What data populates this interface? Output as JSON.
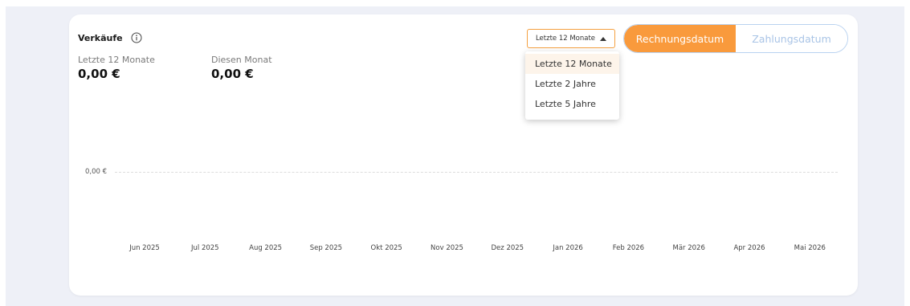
{
  "card": {
    "title": "Verkäufe",
    "stats": [
      {
        "label": "Letzte 12 Monate",
        "value": "0,00 €"
      },
      {
        "label": "Diesen Monat",
        "value": "0,00 €"
      }
    ]
  },
  "controls": {
    "range_selected": "Letzte 12 Monate",
    "range_options": [
      "Letzte 12 Monate",
      "Letzte 2 Jahre",
      "Letzte 5 Jahre"
    ],
    "toggle": {
      "active": "Rechnungsdatum",
      "inactive": "Zahlungsdatum"
    }
  },
  "colors": {
    "accent": "#f99a3c",
    "toggle_border": "#b9d2f0",
    "inactive_text": "#a9c4e6",
    "background": "#eef0f7"
  },
  "chart_data": {
    "type": "line",
    "categories": [
      "Jun 2025",
      "Jul 2025",
      "Aug 2025",
      "Sep 2025",
      "Okt 2025",
      "Nov 2025",
      "Dez 2025",
      "Jan 2026",
      "Feb 2026",
      "Mär 2026",
      "Apr 2026",
      "Mai 2026"
    ],
    "series": [
      {
        "values": [
          0,
          0,
          0,
          0,
          0,
          0,
          0,
          0,
          0,
          0,
          0,
          0
        ]
      }
    ],
    "y_ticks": [
      "0,00 €"
    ],
    "grid": true
  }
}
